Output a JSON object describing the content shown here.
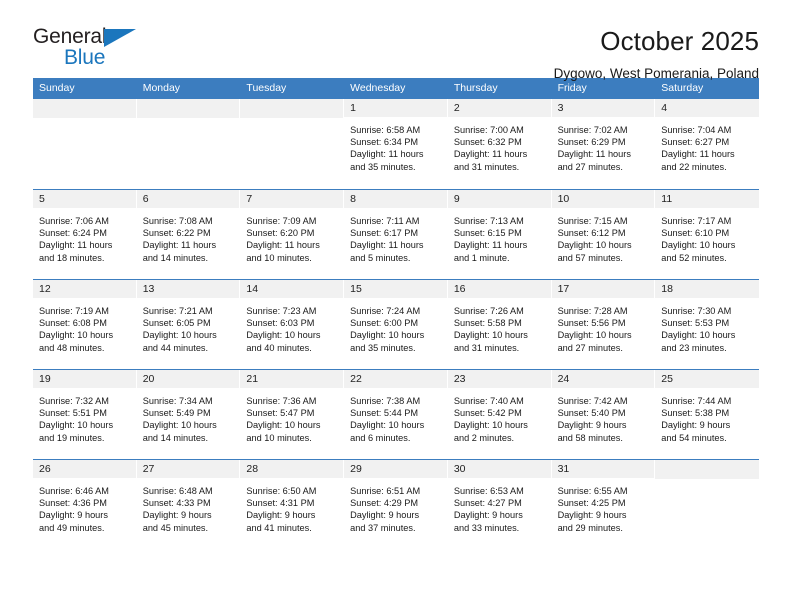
{
  "brand": {
    "name_part1": "General",
    "name_part2": "Blue",
    "accent_color": "#1b76bd"
  },
  "header": {
    "title": "October 2025",
    "subtitle": "Dygowo, West Pomerania, Poland"
  },
  "theme": {
    "header_bar_color": "#3c7dbf",
    "daynum_band_color": "#f1f1f1",
    "text_color": "#1a1a1a"
  },
  "weekdays": [
    "Sunday",
    "Monday",
    "Tuesday",
    "Wednesday",
    "Thursday",
    "Friday",
    "Saturday"
  ],
  "weeks": [
    [
      {
        "day": "",
        "empty": true,
        "sunrise": "",
        "sunset": "",
        "daylight_line1": "",
        "daylight_line2": ""
      },
      {
        "day": "",
        "empty": true,
        "sunrise": "",
        "sunset": "",
        "daylight_line1": "",
        "daylight_line2": ""
      },
      {
        "day": "",
        "empty": true,
        "sunrise": "",
        "sunset": "",
        "daylight_line1": "",
        "daylight_line2": ""
      },
      {
        "day": "1",
        "empty": false,
        "sunrise": "Sunrise: 6:58 AM",
        "sunset": "Sunset: 6:34 PM",
        "daylight_line1": "Daylight: 11 hours",
        "daylight_line2": "and 35 minutes."
      },
      {
        "day": "2",
        "empty": false,
        "sunrise": "Sunrise: 7:00 AM",
        "sunset": "Sunset: 6:32 PM",
        "daylight_line1": "Daylight: 11 hours",
        "daylight_line2": "and 31 minutes."
      },
      {
        "day": "3",
        "empty": false,
        "sunrise": "Sunrise: 7:02 AM",
        "sunset": "Sunset: 6:29 PM",
        "daylight_line1": "Daylight: 11 hours",
        "daylight_line2": "and 27 minutes."
      },
      {
        "day": "4",
        "empty": false,
        "sunrise": "Sunrise: 7:04 AM",
        "sunset": "Sunset: 6:27 PM",
        "daylight_line1": "Daylight: 11 hours",
        "daylight_line2": "and 22 minutes."
      }
    ],
    [
      {
        "day": "5",
        "empty": false,
        "sunrise": "Sunrise: 7:06 AM",
        "sunset": "Sunset: 6:24 PM",
        "daylight_line1": "Daylight: 11 hours",
        "daylight_line2": "and 18 minutes."
      },
      {
        "day": "6",
        "empty": false,
        "sunrise": "Sunrise: 7:08 AM",
        "sunset": "Sunset: 6:22 PM",
        "daylight_line1": "Daylight: 11 hours",
        "daylight_line2": "and 14 minutes."
      },
      {
        "day": "7",
        "empty": false,
        "sunrise": "Sunrise: 7:09 AM",
        "sunset": "Sunset: 6:20 PM",
        "daylight_line1": "Daylight: 11 hours",
        "daylight_line2": "and 10 minutes."
      },
      {
        "day": "8",
        "empty": false,
        "sunrise": "Sunrise: 7:11 AM",
        "sunset": "Sunset: 6:17 PM",
        "daylight_line1": "Daylight: 11 hours",
        "daylight_line2": "and 5 minutes."
      },
      {
        "day": "9",
        "empty": false,
        "sunrise": "Sunrise: 7:13 AM",
        "sunset": "Sunset: 6:15 PM",
        "daylight_line1": "Daylight: 11 hours",
        "daylight_line2": "and 1 minute."
      },
      {
        "day": "10",
        "empty": false,
        "sunrise": "Sunrise: 7:15 AM",
        "sunset": "Sunset: 6:12 PM",
        "daylight_line1": "Daylight: 10 hours",
        "daylight_line2": "and 57 minutes."
      },
      {
        "day": "11",
        "empty": false,
        "sunrise": "Sunrise: 7:17 AM",
        "sunset": "Sunset: 6:10 PM",
        "daylight_line1": "Daylight: 10 hours",
        "daylight_line2": "and 52 minutes."
      }
    ],
    [
      {
        "day": "12",
        "empty": false,
        "sunrise": "Sunrise: 7:19 AM",
        "sunset": "Sunset: 6:08 PM",
        "daylight_line1": "Daylight: 10 hours",
        "daylight_line2": "and 48 minutes."
      },
      {
        "day": "13",
        "empty": false,
        "sunrise": "Sunrise: 7:21 AM",
        "sunset": "Sunset: 6:05 PM",
        "daylight_line1": "Daylight: 10 hours",
        "daylight_line2": "and 44 minutes."
      },
      {
        "day": "14",
        "empty": false,
        "sunrise": "Sunrise: 7:23 AM",
        "sunset": "Sunset: 6:03 PM",
        "daylight_line1": "Daylight: 10 hours",
        "daylight_line2": "and 40 minutes."
      },
      {
        "day": "15",
        "empty": false,
        "sunrise": "Sunrise: 7:24 AM",
        "sunset": "Sunset: 6:00 PM",
        "daylight_line1": "Daylight: 10 hours",
        "daylight_line2": "and 35 minutes."
      },
      {
        "day": "16",
        "empty": false,
        "sunrise": "Sunrise: 7:26 AM",
        "sunset": "Sunset: 5:58 PM",
        "daylight_line1": "Daylight: 10 hours",
        "daylight_line2": "and 31 minutes."
      },
      {
        "day": "17",
        "empty": false,
        "sunrise": "Sunrise: 7:28 AM",
        "sunset": "Sunset: 5:56 PM",
        "daylight_line1": "Daylight: 10 hours",
        "daylight_line2": "and 27 minutes."
      },
      {
        "day": "18",
        "empty": false,
        "sunrise": "Sunrise: 7:30 AM",
        "sunset": "Sunset: 5:53 PM",
        "daylight_line1": "Daylight: 10 hours",
        "daylight_line2": "and 23 minutes."
      }
    ],
    [
      {
        "day": "19",
        "empty": false,
        "sunrise": "Sunrise: 7:32 AM",
        "sunset": "Sunset: 5:51 PM",
        "daylight_line1": "Daylight: 10 hours",
        "daylight_line2": "and 19 minutes."
      },
      {
        "day": "20",
        "empty": false,
        "sunrise": "Sunrise: 7:34 AM",
        "sunset": "Sunset: 5:49 PM",
        "daylight_line1": "Daylight: 10 hours",
        "daylight_line2": "and 14 minutes."
      },
      {
        "day": "21",
        "empty": false,
        "sunrise": "Sunrise: 7:36 AM",
        "sunset": "Sunset: 5:47 PM",
        "daylight_line1": "Daylight: 10 hours",
        "daylight_line2": "and 10 minutes."
      },
      {
        "day": "22",
        "empty": false,
        "sunrise": "Sunrise: 7:38 AM",
        "sunset": "Sunset: 5:44 PM",
        "daylight_line1": "Daylight: 10 hours",
        "daylight_line2": "and 6 minutes."
      },
      {
        "day": "23",
        "empty": false,
        "sunrise": "Sunrise: 7:40 AM",
        "sunset": "Sunset: 5:42 PM",
        "daylight_line1": "Daylight: 10 hours",
        "daylight_line2": "and 2 minutes."
      },
      {
        "day": "24",
        "empty": false,
        "sunrise": "Sunrise: 7:42 AM",
        "sunset": "Sunset: 5:40 PM",
        "daylight_line1": "Daylight: 9 hours",
        "daylight_line2": "and 58 minutes."
      },
      {
        "day": "25",
        "empty": false,
        "sunrise": "Sunrise: 7:44 AM",
        "sunset": "Sunset: 5:38 PM",
        "daylight_line1": "Daylight: 9 hours",
        "daylight_line2": "and 54 minutes."
      }
    ],
    [
      {
        "day": "26",
        "empty": false,
        "sunrise": "Sunrise: 6:46 AM",
        "sunset": "Sunset: 4:36 PM",
        "daylight_line1": "Daylight: 9 hours",
        "daylight_line2": "and 49 minutes."
      },
      {
        "day": "27",
        "empty": false,
        "sunrise": "Sunrise: 6:48 AM",
        "sunset": "Sunset: 4:33 PM",
        "daylight_line1": "Daylight: 9 hours",
        "daylight_line2": "and 45 minutes."
      },
      {
        "day": "28",
        "empty": false,
        "sunrise": "Sunrise: 6:50 AM",
        "sunset": "Sunset: 4:31 PM",
        "daylight_line1": "Daylight: 9 hours",
        "daylight_line2": "and 41 minutes."
      },
      {
        "day": "29",
        "empty": false,
        "sunrise": "Sunrise: 6:51 AM",
        "sunset": "Sunset: 4:29 PM",
        "daylight_line1": "Daylight: 9 hours",
        "daylight_line2": "and 37 minutes."
      },
      {
        "day": "30",
        "empty": false,
        "sunrise": "Sunrise: 6:53 AM",
        "sunset": "Sunset: 4:27 PM",
        "daylight_line1": "Daylight: 9 hours",
        "daylight_line2": "and 33 minutes."
      },
      {
        "day": "31",
        "empty": false,
        "sunrise": "Sunrise: 6:55 AM",
        "sunset": "Sunset: 4:25 PM",
        "daylight_line1": "Daylight: 9 hours",
        "daylight_line2": "and 29 minutes."
      },
      {
        "day": "",
        "empty": true,
        "sunrise": "",
        "sunset": "",
        "daylight_line1": "",
        "daylight_line2": ""
      }
    ]
  ]
}
